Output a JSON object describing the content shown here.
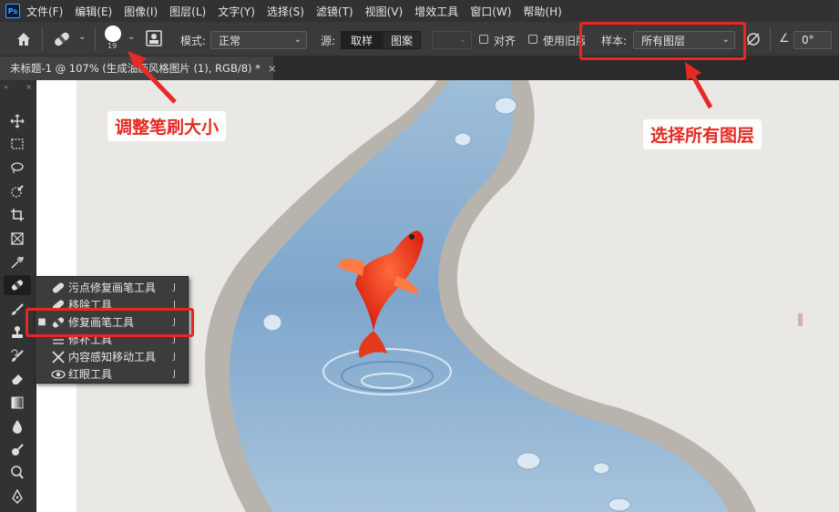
{
  "menubar": {
    "logo": "Ps",
    "items": [
      "文件(F)",
      "编辑(E)",
      "图像(I)",
      "图层(L)",
      "文字(Y)",
      "选择(S)",
      "滤镜(T)",
      "视图(V)",
      "增效工具",
      "窗口(W)",
      "帮助(H)"
    ]
  },
  "options": {
    "brush_size": "19",
    "mode_label": "模式:",
    "mode_value": "正常",
    "source_label": "源:",
    "source_sample": "取样",
    "source_pattern": "图案",
    "align_label": "对齐",
    "legacy_label": "使用旧版",
    "sample_label": "样本:",
    "sample_value": "所有图层",
    "angle_value": "0°"
  },
  "document_tab": {
    "title": "未标题-1 @ 107% (生成油画风格图片 (1), RGB/8) *",
    "close": "×"
  },
  "toolbar": {
    "collapse": "»",
    "close": "×"
  },
  "flyout": {
    "items": [
      {
        "label": "污点修复画笔工具",
        "shortcut": "J",
        "selected": false
      },
      {
        "label": "移除工具",
        "shortcut": "J",
        "selected": false
      },
      {
        "label": "修复画笔工具",
        "shortcut": "J",
        "selected": true
      },
      {
        "label": "修补工具",
        "shortcut": "J",
        "selected": false
      },
      {
        "label": "内容感知移动工具",
        "shortcut": "J",
        "selected": false
      },
      {
        "label": "红眼工具",
        "shortcut": "J",
        "selected": false
      }
    ],
    "selected_marker": "■"
  },
  "annotations": {
    "brush_size_callout": "调整笔刷大小",
    "sample_callout": "选择所有图层",
    "highlight_color": "#e82626"
  },
  "colors": {
    "accent_red": "#e52b22",
    "ui_dark": "#323232"
  }
}
